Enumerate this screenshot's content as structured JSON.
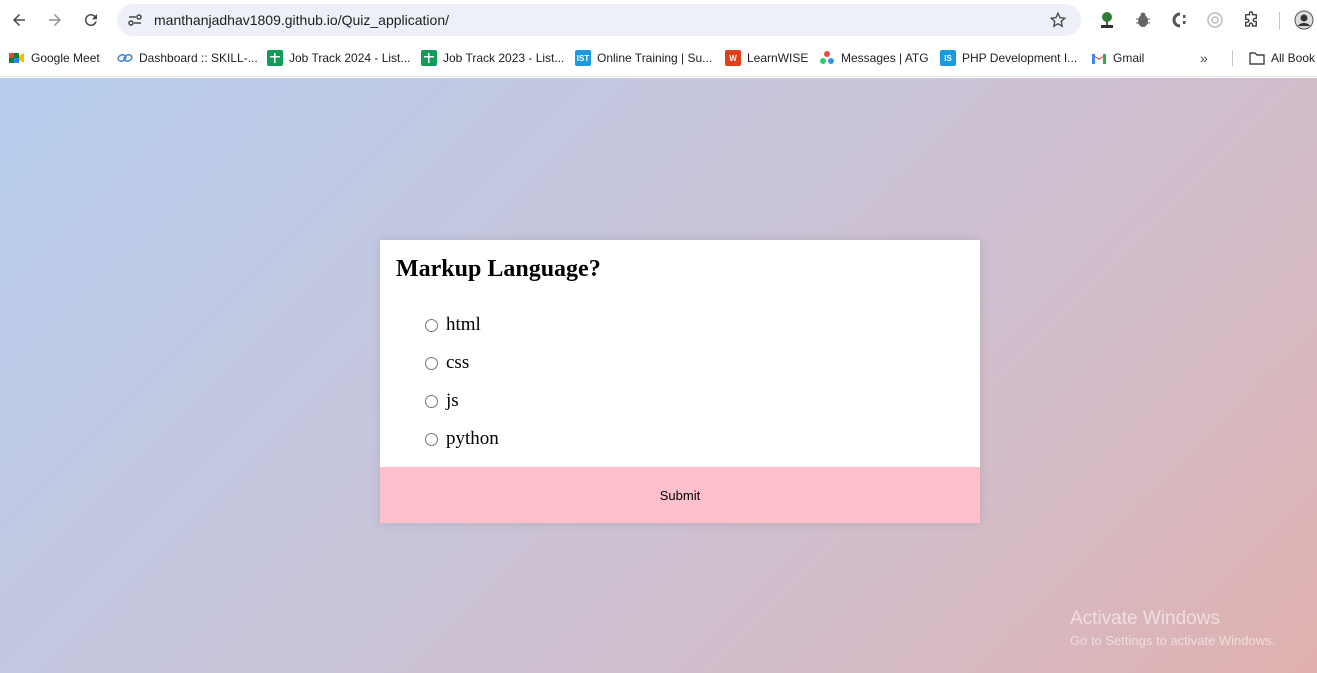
{
  "browser": {
    "url": "manthanjadhav1809.github.io/Quiz_application/"
  },
  "bookmarks": {
    "items": [
      {
        "label": "Google Meet"
      },
      {
        "label": "Dashboard :: SKILL-..."
      },
      {
        "label": "Job Track 2024 - List..."
      },
      {
        "label": "Job Track 2023 - List..."
      },
      {
        "label": "Online Training | Su..."
      },
      {
        "label": "LearnWISE"
      },
      {
        "label": "Messages | ATG"
      },
      {
        "label": "PHP Development I..."
      },
      {
        "label": "Gmail"
      }
    ],
    "more_label": "»",
    "all_bookmarks_label": "All Book",
    "favicon_text": {
      "online_training": "IST",
      "learnwise": "W",
      "php": "IS"
    }
  },
  "quiz": {
    "question": "Markup Language?",
    "options": [
      "html",
      "css",
      "js",
      "python"
    ],
    "submit_label": "Submit"
  },
  "watermark": {
    "line1": "Activate Windows",
    "line2": "Go to Settings to activate Windows."
  },
  "colors": {
    "submit_bg": "#ffc0cb",
    "gradient_start": "#b7ceef",
    "gradient_end": "#e0b0ae"
  }
}
